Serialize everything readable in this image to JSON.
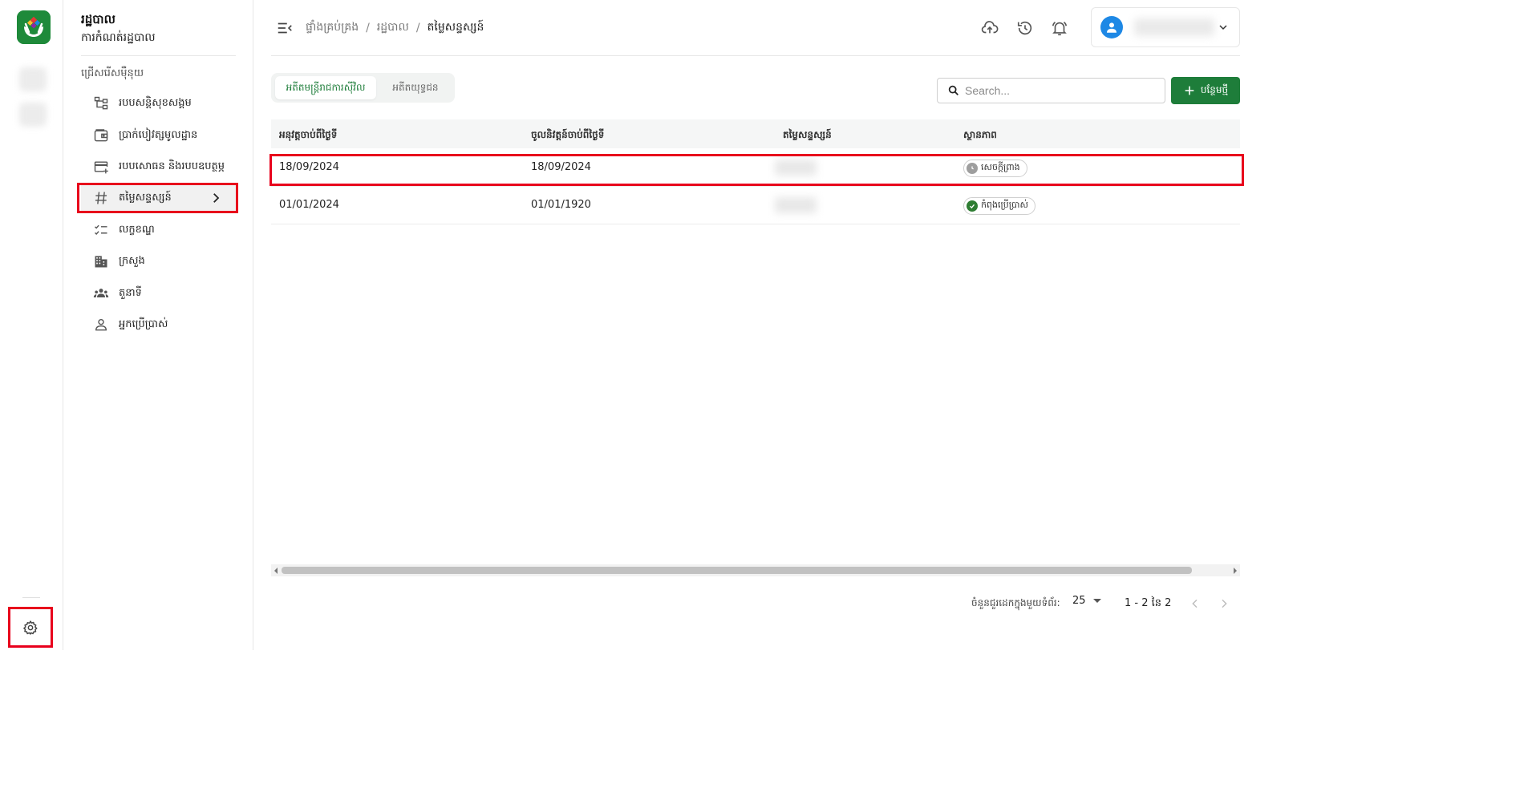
{
  "sidebar": {
    "title": "រដ្ឋបាល",
    "subtitle": "ការកំណត់រដ្ឋបាល",
    "section_label": "ជ្រើសរើសម៉ឺនុយ",
    "items": [
      {
        "label": "របបសន្តិសុខសង្គម",
        "icon": "sitemap-icon"
      },
      {
        "label": "ប្រាក់បៀវត្សមូលដ្ឋាន",
        "icon": "wallet-icon"
      },
      {
        "label": "របបសោធន និងរបបឧបត្ថម្ភ",
        "icon": "card-add-icon"
      },
      {
        "label": "តម្លៃសន្ទស្សន៍",
        "icon": "hash-icon",
        "active": true
      },
      {
        "label": "លក្ខខណ្ឌ",
        "icon": "checklist-icon"
      },
      {
        "label": "ក្រសួង",
        "icon": "building-icon"
      },
      {
        "label": "តួនាទី",
        "icon": "group-icon"
      },
      {
        "label": "អ្នកប្រើប្រាស់",
        "icon": "person-icon"
      }
    ]
  },
  "breadcrumb": [
    "ផ្ទាំងគ្រប់គ្រង",
    "រដ្ឋបាល",
    "តម្លៃសន្ទស្សន៍"
  ],
  "tabs": [
    {
      "label": "អតីតមន្ត្រីរាជការស៊ីវិល",
      "active": true
    },
    {
      "label": "អតីតយុទ្ធជន",
      "active": false
    }
  ],
  "search": {
    "placeholder": "Search..."
  },
  "add_button": {
    "label": "បន្ថែមថ្មី"
  },
  "table": {
    "headers": [
      "អនុវត្តចាប់ពីថ្ងៃទី",
      "ចូលនិវត្តន៍ចាប់ពីថ្ងៃទី",
      "តម្លៃសន្ទស្សន៍",
      "ស្ថានភាព"
    ],
    "rows": [
      {
        "apply_from": "18/09/2024",
        "retire_from": "18/09/2024",
        "status": "សេចក្តីព្រាង",
        "status_kind": "draft"
      },
      {
        "apply_from": "01/01/2024",
        "retire_from": "01/01/1920",
        "status": "កំពុងប្រើប្រាស់",
        "status_kind": "active"
      }
    ]
  },
  "pagination": {
    "rows_per_page_label": "ចំនួនជួរដេកក្នុងមួយទំព័រ:",
    "rows_per_page": "25",
    "range": "1 - 2 នៃ 2"
  },
  "colors": {
    "brand_green": "#1e7d3a",
    "highlight_red": "#e8001c",
    "avatar_blue": "#1e88e5"
  }
}
